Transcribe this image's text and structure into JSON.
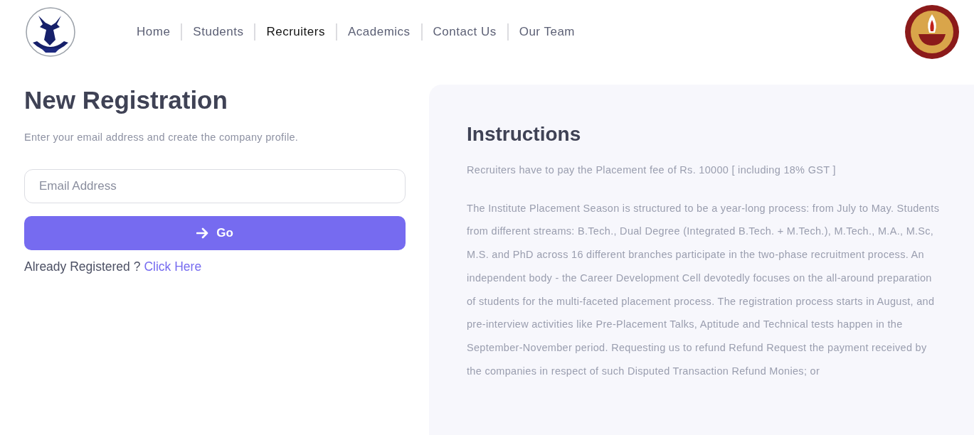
{
  "nav": [
    {
      "label": "Home",
      "selected": false
    },
    {
      "label": "Students",
      "selected": false
    },
    {
      "label": "Recruiters",
      "selected": true
    },
    {
      "label": "Academics",
      "selected": false
    },
    {
      "label": "Contact Us",
      "selected": false
    },
    {
      "label": "Our Team",
      "selected": false
    }
  ],
  "registration": {
    "title": "New Registration",
    "subtitle": "Enter your email address and create the company profile.",
    "email": {
      "placeholder": "Email Address"
    },
    "button": "Go",
    "already": "Already Registered ?",
    "link": "Click Here"
  },
  "instructions": {
    "title": "Instructions",
    "fee_note": "Recruiters have to pay the Placement fee of Rs. 10000 [ including 18% GST ]",
    "body": "The Institute Placement Season is structured to be a year-long process: from July to May. Students from different streams: B.Tech., Dual Degree (Integrated B.Tech. + M.Tech.), M.Tech., M.A., M.Sc, M.S. and PhD across 16 different branches participate in the two-phase recruitment process. An independent body - the Career Development Cell devotedly focuses on the all-around preparation of students for the multi-faceted placement process. The registration process starts in August, and pre-interview activities like Pre-Placement Talks, Aptitude and Technical tests happen in the September-November period. Requesting us to refund Refund Request the payment received by the companies in respect of such Disputed Transaction Refund Monies; or"
  }
}
